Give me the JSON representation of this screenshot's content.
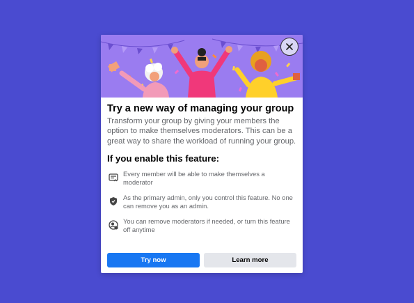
{
  "dialog": {
    "title": "Try a new way of managing your group",
    "description": "Transform your group by giving your members the option to make themselves moderators. This can be a great way to share the workload of running your group.",
    "subtitle": "If you enable this feature:",
    "features": [
      {
        "icon": "moderator-badge-icon",
        "text": "Every member will be able to make themselves a moderator"
      },
      {
        "icon": "shield-icon",
        "text": "As the primary admin, only you control this feature. No one can remove you as an admin."
      },
      {
        "icon": "person-settings-icon",
        "text": "You can remove moderators if needed, or turn this feature off anytime"
      }
    ],
    "primary_button": "Try now",
    "secondary_button": "Learn more",
    "close_icon": "close-icon"
  },
  "colors": {
    "background": "#4a4bd0",
    "hero": "#9a7cf0",
    "primary": "#1877f2",
    "secondary": "#e4e6eb"
  }
}
